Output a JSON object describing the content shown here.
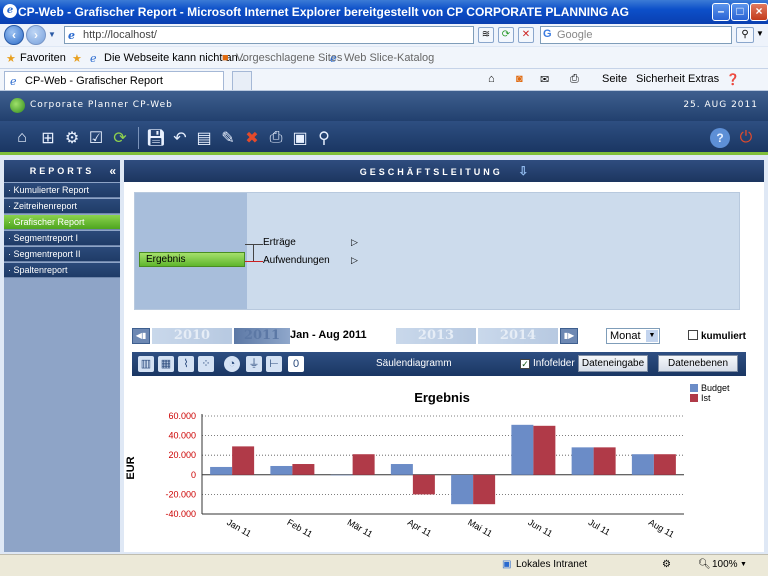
{
  "window": {
    "title": "CP-Web - Grafischer Report - Microsoft Internet Explorer bereitgestellt von CP CORPORATE PLANNING AG"
  },
  "address": {
    "url": "http://localhost/",
    "search_placeholder": "Google"
  },
  "favorites": {
    "label": "Favoriten",
    "items": [
      "Die Webseite kann nicht an...",
      "Vorgeschlagene Sites",
      "Web Slice-Katalog"
    ]
  },
  "tabs": [
    {
      "label": "CP-Web - Grafischer Report"
    }
  ],
  "ie_menu": {
    "seite": "Seite",
    "sicherheit": "Sicherheit",
    "extras": "Extras"
  },
  "app": {
    "name": "Corporate Planner CP-Web",
    "date": "25. AUG 2011"
  },
  "sidebar": {
    "title": "REPORTS",
    "items": [
      {
        "label": "Kumulierter Report",
        "active": false
      },
      {
        "label": "Zeitreihenreport",
        "active": false
      },
      {
        "label": "Grafischer Report",
        "active": true
      },
      {
        "label": "Segmentreport I",
        "active": false
      },
      {
        "label": "Segmentreport II",
        "active": false
      },
      {
        "label": "Spaltenreport",
        "active": false
      }
    ]
  },
  "main": {
    "title": "GESCHÄFTSLEITUNG",
    "tree": {
      "node": "Ergebnis",
      "children": [
        "Erträge",
        "Aufwendungen"
      ]
    },
    "years": [
      "2010",
      "2011",
      "2013",
      "2014"
    ],
    "period": "Jan - Aug 2011",
    "interval": "Monat",
    "cumulative_label": "kumuliert",
    "chart_type_label": "Säulendiagramm",
    "infofelder_label": "Infofelder",
    "dateneingabe_label": "Dateneingabe",
    "datenebenen_label": "Datenebenen"
  },
  "status": {
    "zone": "Lokales Intranet",
    "zoom": "100%"
  },
  "chart_data": {
    "type": "bar",
    "title": "Ergebnis",
    "ylabel": "EUR",
    "categories": [
      "Jan 11",
      "Feb 11",
      "Mär 11",
      "Apr 11",
      "Mai 11",
      "Jun 11",
      "Jul 11",
      "Aug 11"
    ],
    "series": [
      {
        "name": "Budget",
        "color": "#6b8cc7",
        "values": [
          8000,
          9000,
          0,
          11000,
          -30000,
          51000,
          28000,
          21000
        ]
      },
      {
        "name": "Ist",
        "color": "#b03a48",
        "values": [
          29000,
          11000,
          21000,
          -20000,
          -30000,
          50000,
          28000,
          21000
        ]
      }
    ],
    "yticks": [
      60000,
      40000,
      20000,
      0,
      -20000,
      -40000
    ],
    "ytick_labels": [
      "60.000",
      "40.000",
      "20.000",
      "0",
      "-20.000",
      "-40.000"
    ],
    "ylim": [
      -40000,
      60000
    ],
    "grid": true,
    "legend": "top-right"
  }
}
